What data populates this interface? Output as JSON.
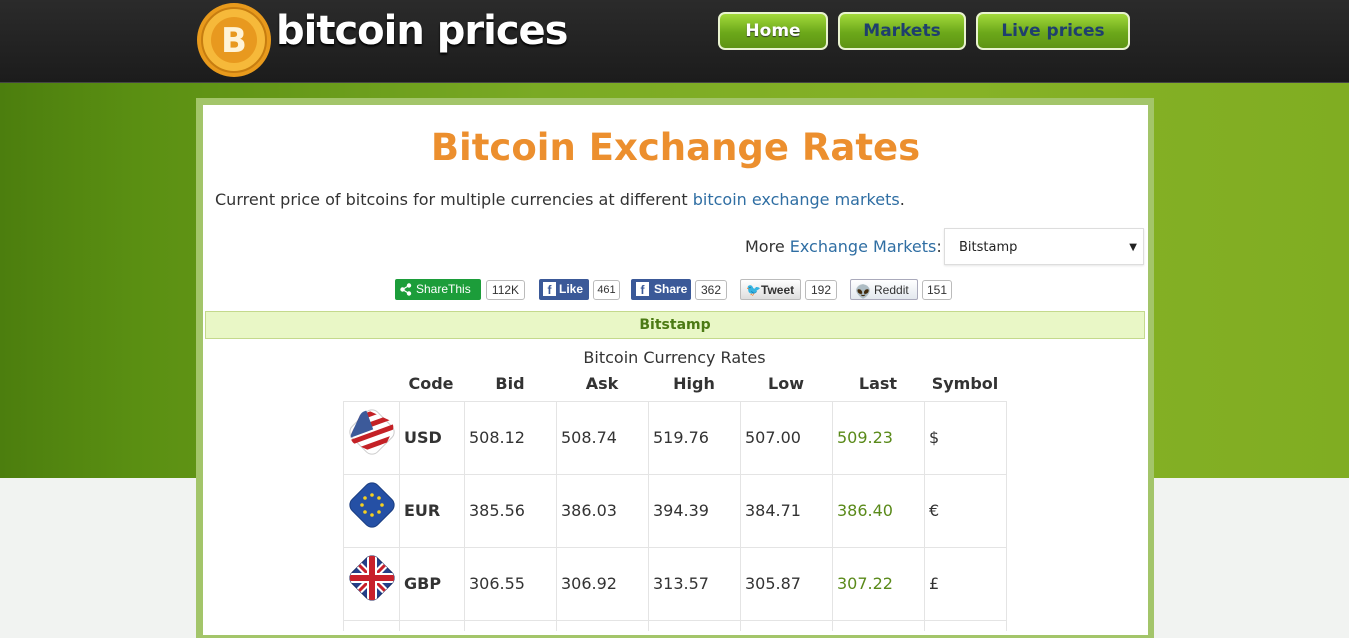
{
  "header": {
    "logo_text": "bitcoin prices",
    "nav": [
      {
        "label": "Home"
      },
      {
        "label": "Markets"
      },
      {
        "label": "Live prices"
      }
    ]
  },
  "main": {
    "title": "Bitcoin Exchange Rates",
    "intro_text": "Current price of bitcoins for multiple currencies at different ",
    "intro_link": "bitcoin exchange markets",
    "intro_end": ".",
    "more_label": "More ",
    "more_link": "Exchange Markets",
    "more_colon": ":",
    "selected_market": "Bitstamp"
  },
  "share": {
    "sharethis": {
      "label": "ShareThis",
      "count": "112K"
    },
    "like": {
      "label": "Like",
      "count": "461"
    },
    "share": {
      "label": "Share",
      "count": "362"
    },
    "tweet": {
      "label": "Tweet",
      "count": "192"
    },
    "reddit": {
      "label": "Reddit",
      "count": "151"
    }
  },
  "table": {
    "market_name": "Bitstamp",
    "caption": "Bitcoin Currency Rates",
    "headers": [
      "Code",
      "Bid",
      "Ask",
      "High",
      "Low",
      "Last",
      "Symbol"
    ],
    "rows": [
      {
        "code": "USD",
        "bid": "508.12",
        "ask": "508.74",
        "high": "519.76",
        "low": "507.00",
        "last": "509.23",
        "symbol": "$"
      },
      {
        "code": "EUR",
        "bid": "385.56",
        "ask": "386.03",
        "high": "394.39",
        "low": "384.71",
        "last": "386.40",
        "symbol": "€"
      },
      {
        "code": "GBP",
        "bid": "306.55",
        "ask": "306.92",
        "high": "313.57",
        "low": "305.87",
        "last": "307.22",
        "symbol": "£"
      }
    ]
  },
  "colors": {
    "title_orange": "#ec8f2e",
    "nav_green": "#7cb422",
    "link_blue": "#2f6ea3",
    "last_price_green": "#5a8a1a"
  }
}
